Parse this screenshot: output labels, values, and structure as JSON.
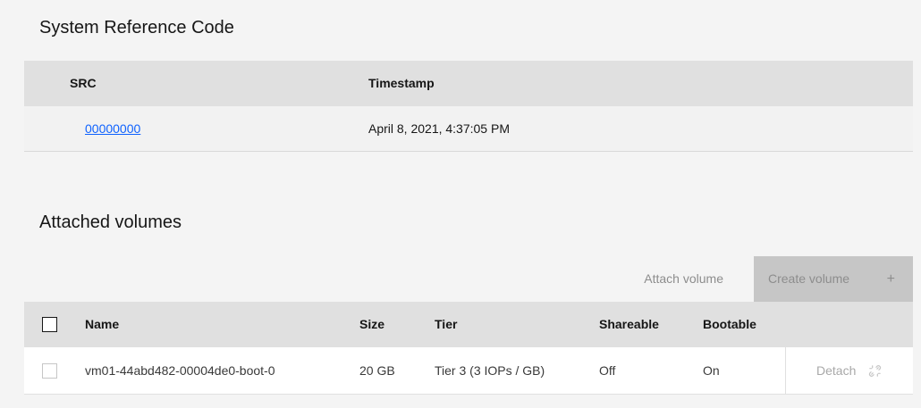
{
  "src_section": {
    "title": "System Reference Code",
    "columns": [
      "SRC",
      "Timestamp"
    ],
    "rows": [
      {
        "src": "00000000",
        "timestamp": "April 8, 2021, 4:37:05 PM"
      }
    ]
  },
  "volumes_section": {
    "title": "Attached volumes",
    "toolbar": {
      "attach_label": "Attach volume",
      "create_label": "Create volume",
      "create_icon": "+"
    },
    "columns": [
      "Name",
      "Size",
      "Tier",
      "Shareable",
      "Bootable"
    ],
    "rows": [
      {
        "name": "vm01-44abd482-00004de0-boot-0",
        "size": "20 GB",
        "tier": "Tier 3 (3 IOPs / GB)",
        "shareable": "Off",
        "bootable": "On",
        "action_label": "Detach",
        "action_icon": "detach-icon"
      }
    ]
  },
  "colors": {
    "background": "#f4f4f4",
    "header_bg": "#e0e0e0",
    "link": "#0f62fe",
    "disabled_button_bg": "#c6c6c6",
    "disabled_text": "#8d8d8d"
  }
}
